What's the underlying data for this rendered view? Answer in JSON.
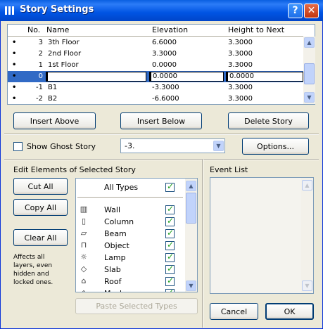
{
  "window": {
    "title": "Story Settings",
    "help_label": "?",
    "close_label": "✕"
  },
  "stories": {
    "columns": [
      "No.",
      "Name",
      "Elevation",
      "Height to Next"
    ],
    "rows": [
      {
        "marker": "•",
        "no": "3",
        "name": "3th Floor",
        "elevation": "6.6000",
        "height": "3.3000",
        "selected": false
      },
      {
        "marker": "•",
        "no": "2",
        "name": "2nd Floor",
        "elevation": "3.3000",
        "height": "3.3000",
        "selected": false
      },
      {
        "marker": "•",
        "no": "1",
        "name": "1st Floor",
        "elevation": "0.0000",
        "height": "3.3000",
        "selected": false
      },
      {
        "marker": "•",
        "no": "0",
        "name": "",
        "elevation": "0.0000",
        "height": "0.0000",
        "selected": true
      },
      {
        "marker": "•",
        "no": "-1",
        "name": "B1",
        "elevation": "-3.3000",
        "height": "3.3000",
        "selected": false
      },
      {
        "marker": "•",
        "no": "-2",
        "name": "B2",
        "elevation": "-6.6000",
        "height": "3.3000",
        "selected": false
      }
    ]
  },
  "buttons": {
    "insert_above": "Insert Above",
    "insert_below": "Insert Below",
    "delete_story": "Delete Story",
    "options": "Options...",
    "cut_all": "Cut All",
    "copy_all": "Copy All",
    "clear_all": "Clear All",
    "paste_selected": "Paste Selected Types",
    "cancel": "Cancel",
    "ok": "OK"
  },
  "ghost": {
    "label": "Show Ghost Story",
    "checked": false,
    "value": "-3."
  },
  "edit_section": {
    "title": "Edit Elements of Selected Story",
    "note": "Affects all layers, even hidden and locked ones.",
    "all_types": {
      "label": "All Types",
      "checked": true
    },
    "types": [
      {
        "label": "Wall",
        "icon": "wall-icon",
        "glyph": "▥",
        "checked": true
      },
      {
        "label": "Column",
        "icon": "column-icon",
        "glyph": "▯",
        "checked": true
      },
      {
        "label": "Beam",
        "icon": "beam-icon",
        "glyph": "▱",
        "checked": true
      },
      {
        "label": "Object",
        "icon": "object-icon",
        "glyph": "⊓",
        "checked": true
      },
      {
        "label": "Lamp",
        "icon": "lamp-icon",
        "glyph": "☼",
        "checked": true
      },
      {
        "label": "Slab",
        "icon": "slab-icon",
        "glyph": "◇",
        "checked": true
      },
      {
        "label": "Roof",
        "icon": "roof-icon",
        "glyph": "⌂",
        "checked": true
      },
      {
        "label": "Mesh",
        "icon": "mesh-icon",
        "glyph": "◈",
        "checked": true
      }
    ]
  },
  "event_list": {
    "title": "Event List"
  },
  "colors": {
    "selection": "#316AC5",
    "title_blue": "#0054E3",
    "face": "#ECE9D8"
  }
}
